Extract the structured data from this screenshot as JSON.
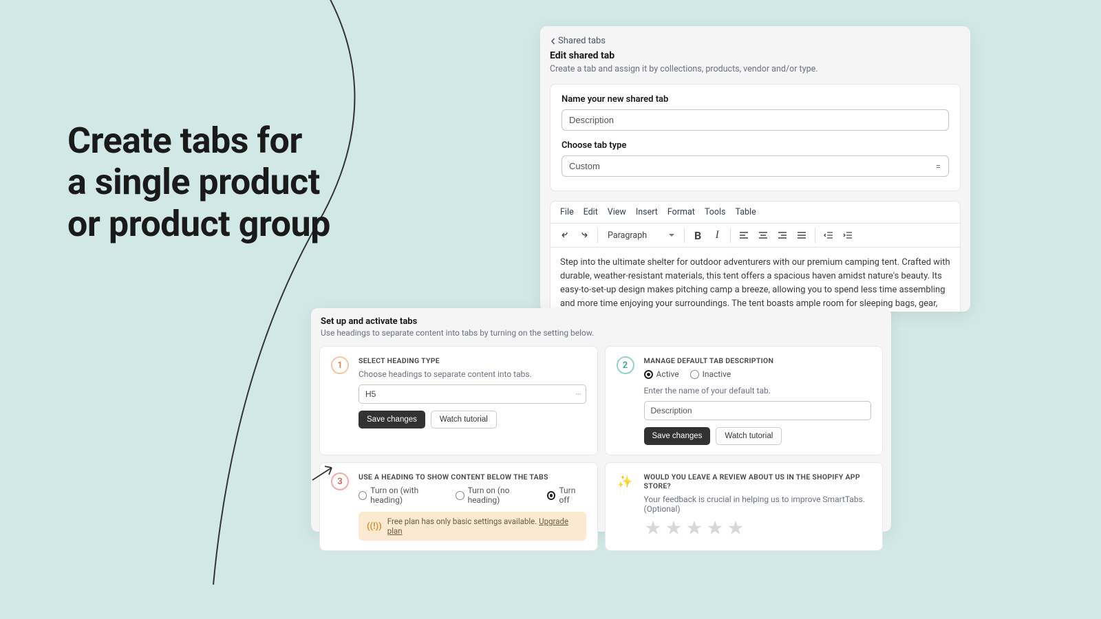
{
  "headline": {
    "l1": "Create tabs for",
    "l2": "a single product",
    "l3": "or product group"
  },
  "top": {
    "back": "Shared tabs",
    "title": "Edit shared tab",
    "subtitle": "Create a tab and assign it by collections, products, vendor and/or type.",
    "name_label": "Name your new shared tab",
    "name_value": "Description",
    "type_label": "Choose tab type",
    "type_value": "Custom",
    "menu": {
      "file": "File",
      "edit": "Edit",
      "view": "View",
      "insert": "Insert",
      "format": "Format",
      "tools": "Tools",
      "table": "Table"
    },
    "paragraph": "Paragraph",
    "content": "Step into the ultimate shelter for outdoor adventurers with our premium camping tent. Crafted with durable, weather-resistant materials, this tent offers a spacious haven amidst nature's beauty. Its easy-to-set-up design makes pitching camp a breeze, allowing you to spend less time assembling and more time enjoying your surroundings. The tent boasts ample room for sleeping bags, gear, and even standing space, ensuring comfort and convenience. With excellent ventilation to keep things fresh and a sturdy build to withstand various elements, our camping tent is your reliable companion for memorable outdoor experiences."
  },
  "bottom": {
    "title": "Set up and activate tabs",
    "subtitle": "Use headings to separate content into tabs by turning on the setting below.",
    "step1": {
      "num": "1",
      "title": "SELECT HEADING TYPE",
      "sub": "Choose headings to separate content into tabs.",
      "value": "H5",
      "save": "Save changes",
      "watch": "Watch tutorial"
    },
    "step2": {
      "num": "2",
      "title": "MANAGE DEFAULT TAB DESCRIPTION",
      "active": "Active",
      "inactive": "Inactive",
      "enter": "Enter the name of your default tab.",
      "value": "Description",
      "save": "Save changes",
      "watch": "Watch tutorial"
    },
    "step3": {
      "num": "3",
      "title": "USE A HEADING TO SHOW CONTENT BELOW THE TABS",
      "r1": "Turn on (with heading)",
      "r2": "Turn on (no heading)",
      "r3": "Turn off",
      "banner": "Free plan has only basic settings available.",
      "upgrade": "Upgrade plan"
    },
    "review": {
      "title": "WOULD YOU LEAVE A REVIEW ABOUT US IN THE SHOPIFY APP STORE?",
      "sub": "Your feedback is crucial in helping us to improve SmartTabs. (Optional)"
    }
  }
}
